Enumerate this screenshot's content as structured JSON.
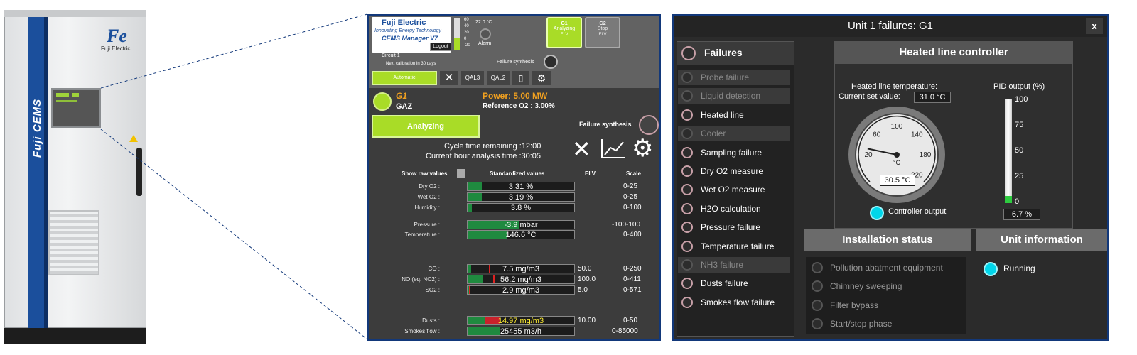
{
  "cabinet": {
    "brand_vertical": "Fuji CEMS",
    "logo_text": "Fuji Electric"
  },
  "screen1": {
    "brand": "Fuji Electric",
    "tagline": "Innovating Energy Technology",
    "app_name": "CEMS Manager V7",
    "user_label": "User : FUJIADMIN",
    "logout": "Logout",
    "thermo_ticks": [
      "60",
      "40",
      "20",
      "0",
      "-20"
    ],
    "temp": "22.0 °C",
    "alarm": "Alarm",
    "g1": {
      "name": "G1",
      "status": "Analyzing",
      "elv": "ELV"
    },
    "g2": {
      "name": "G2",
      "status": "Stop",
      "elv": "ELV"
    },
    "circuit": "Circuit 1",
    "next_calibration": "Next calibration in 30 days",
    "failure_synthesis_top": "Failure synthesis",
    "mode_button": "Automatic",
    "tabs": [
      "QAL3",
      "QAL2"
    ],
    "gas_name": "G1",
    "gas_type": "GAZ",
    "power": "Power: 5.00 MW",
    "reference_o2": "Reference O2 : 3.00%",
    "analyzing_button": "Analyzing",
    "failure_synthesis": "Failure synthesis",
    "cycle_time": "Cycle time remaining :12:00",
    "hour_analysis": "Current hour analysis time :30:05",
    "headers": {
      "raw": "Show raw values",
      "std": "Standardized values",
      "elv": "ELV",
      "scale": "Scale"
    },
    "measurements": [
      {
        "label": "Dry O2 :",
        "value": "3.31 %",
        "fill_pct": 13,
        "elv": "",
        "scale": "0-25"
      },
      {
        "label": "Wet O2 :",
        "value": "3.19 %",
        "fill_pct": 13,
        "elv": "",
        "scale": "0-25"
      },
      {
        "label": "Humidity :",
        "value": "3.8 %",
        "fill_pct": 4,
        "elv": "",
        "scale": "0-100"
      },
      {
        "label": "Pressure :",
        "value": "-3.9 mbar",
        "fill_pct": 48,
        "elv": "",
        "scale": "-100-100"
      },
      {
        "label": "Temperature :",
        "value": "146.6 °C",
        "fill_pct": 37,
        "elv": "",
        "scale": "0-400"
      },
      {
        "label": "CO :",
        "value": "7.5 mg/m3",
        "fill_pct": 3,
        "elv": "50.0",
        "scale": "0-250"
      },
      {
        "label": "NO (eq. NO2) :",
        "value": "56.2 mg/m3",
        "fill_pct": 14,
        "elv": "100.0",
        "scale": "0-411"
      },
      {
        "label": "SO2 :",
        "value": "2.9 mg/m3",
        "fill_pct": 1,
        "elv": "5.0",
        "scale": "0-571"
      },
      {
        "label": "Dusts :",
        "value": "14.97 mg/m3",
        "fill_pct": 30,
        "elv": "10.00",
        "scale": "0-50"
      },
      {
        "label": "Smokes flow :",
        "value": "25455 m3/h",
        "fill_pct": 30,
        "elv": "",
        "scale": "0-85000"
      }
    ]
  },
  "screen2": {
    "title": "Unit 1 failures: G1",
    "close": "x",
    "failures_header": "Failures",
    "failures": [
      {
        "label": "Probe failure",
        "dim": true
      },
      {
        "label": "Liquid detection",
        "dim": true
      },
      {
        "label": "Heated line",
        "dim": false
      },
      {
        "label": "Cooler",
        "dim": true
      },
      {
        "label": "Sampling failure",
        "dim": false
      },
      {
        "label": "Dry O2 measure",
        "dim": false
      },
      {
        "label": "Wet O2 measure",
        "dim": false
      },
      {
        "label": "H2O calculation",
        "dim": false
      },
      {
        "label": "Pressure failure",
        "dim": false
      },
      {
        "label": "Temperature failure",
        "dim": false
      },
      {
        "label": "NH3 failure",
        "dim": true
      },
      {
        "label": "Dusts failure",
        "dim": false
      },
      {
        "label": "Smokes flow failure",
        "dim": false
      }
    ],
    "heated_header": "Heated line controller",
    "heated_temp_label": "Heated line temperature:",
    "set_value_label": "Current set value:",
    "set_value": "31.0 °C",
    "gauge_ticks": [
      "20",
      "60",
      "100",
      "140",
      "180",
      "220"
    ],
    "gauge_unit": "°C",
    "gauge_value": "30.5 °C",
    "gauge_value_num": 30.5,
    "pid_label": "PID output (%)",
    "pid_ticks": [
      "100",
      "75",
      "50",
      "25",
      "0"
    ],
    "pid_value": "6.7 %",
    "pid_value_num": 6.7,
    "controller_output": "Controller output",
    "installation_header": "Installation status",
    "installation": [
      "Pollution abatment equipment",
      "Chimney sweeping",
      "Filter bypass",
      "Start/stop phase"
    ],
    "unit_header": "Unit information",
    "unit_status": "Running"
  },
  "colors": {
    "accent_green": "#a9dc27",
    "brand_blue": "#1b4f9c",
    "orange": "#f0a020",
    "cyan": "#00d6ea"
  }
}
